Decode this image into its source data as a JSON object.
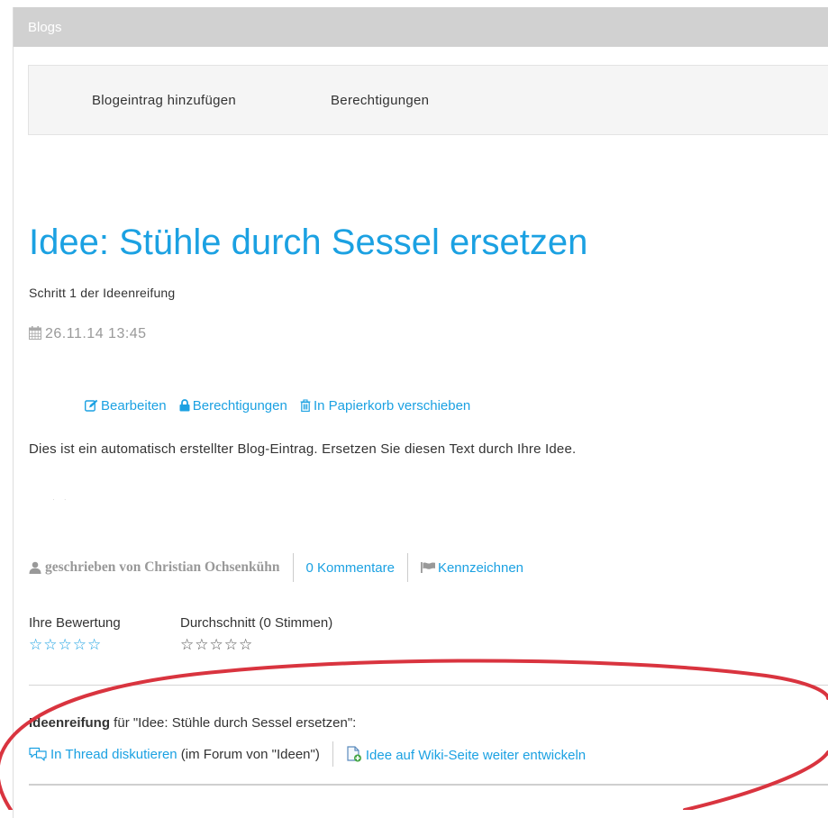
{
  "panel": {
    "title": "Blogs"
  },
  "toolbar": {
    "add_entry": "Blogeintrag hinzufügen",
    "permissions": "Berechtigungen"
  },
  "post": {
    "title": "Idee: Stühle durch Sessel ersetzen",
    "subtitle": "Schritt 1 der Ideenreifung",
    "date": "26.11.14 13:45",
    "actions": {
      "edit": "Bearbeiten",
      "permissions": "Berechtigungen",
      "trash": "In Papierkorb verschieben"
    },
    "body": "Dies ist ein automatisch erstellter Blog-Eintrag. Ersetzen Sie diesen Text durch Ihre Idee.",
    "meta": {
      "author": "geschrieben von Christian Ochsenkühn",
      "comments": "0 Kommentare",
      "flag": "Kennzeichnen"
    }
  },
  "rating": {
    "yours_label": "Ihre Bewertung",
    "yours_stars": "☆☆☆☆☆",
    "average_label": "Durchschnitt (0 Stimmen)",
    "average_stars": "☆☆☆☆☆"
  },
  "ideenreifung": {
    "label_bold": "Ideenreifung",
    "label_rest": " für \"Idee: Stühle durch Sessel ersetzen\":",
    "thread_link": "In Thread diskutieren",
    "thread_note": " (im Forum von \"Ideen\")",
    "wiki_link": "Idee auf Wiki-Seite weiter entwickeln"
  },
  "colors": {
    "accent": "#1ba1e2",
    "header": "#d1d1d1",
    "annotation": "#d9343f",
    "muted": "#999999"
  },
  "icons": {
    "date": "calendar-icon",
    "edit": "edit-icon",
    "lock": "lock-icon",
    "trash": "trash-icon",
    "author": "user-icon",
    "flag": "flag-icon",
    "thread": "speech-bubbles-icon",
    "wiki": "wiki-page-add-icon"
  }
}
